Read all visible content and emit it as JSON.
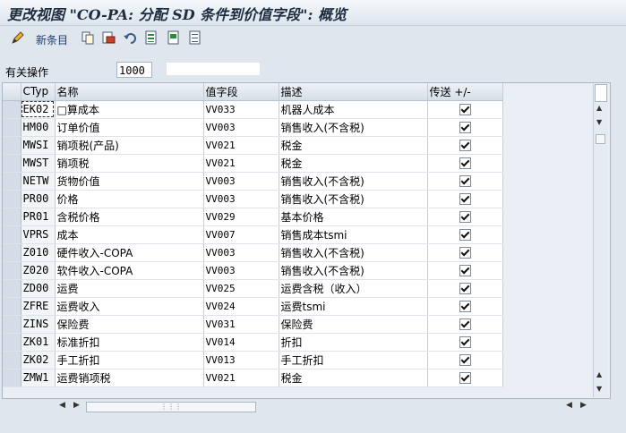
{
  "window": {
    "title": "更改视图 \"CO-PA: 分配 SD 条件到价值字段\": 概览"
  },
  "toolbar": {
    "new_entries_label": "新条目"
  },
  "related": {
    "label": "有关操作",
    "value": "1000"
  },
  "table": {
    "headers": {
      "code": "CTyp",
      "name": "名称",
      "field": "值字段",
      "desc": "描述",
      "transfer": "传送 +/-"
    },
    "rows": [
      {
        "code": "EK02",
        "name": "□算成本",
        "field": "VV033",
        "desc": "机器人成本",
        "transfer": true
      },
      {
        "code": "HM00",
        "name": "订单价值",
        "field": "VV003",
        "desc": "销售收入(不含税)",
        "transfer": true
      },
      {
        "code": "MWSI",
        "name": "销项税(产品)",
        "field": "VV021",
        "desc": "税金",
        "transfer": true
      },
      {
        "code": "MWST",
        "name": "销项税",
        "field": "VV021",
        "desc": "税金",
        "transfer": true
      },
      {
        "code": "NETW",
        "name": "货物价值",
        "field": "VV003",
        "desc": "销售收入(不含税)",
        "transfer": true
      },
      {
        "code": "PR00",
        "name": "价格",
        "field": "VV003",
        "desc": "销售收入(不含税)",
        "transfer": true
      },
      {
        "code": "PR01",
        "name": "含税价格",
        "field": "VV029",
        "desc": "基本价格",
        "transfer": true
      },
      {
        "code": "VPRS",
        "name": "成本",
        "field": "VV007",
        "desc": "销售成本tsmi",
        "transfer": true
      },
      {
        "code": "Z010",
        "name": "硬件收入-COPA",
        "field": "VV003",
        "desc": "销售收入(不含税)",
        "transfer": true
      },
      {
        "code": "Z020",
        "name": "软件收入-COPA",
        "field": "VV003",
        "desc": "销售收入(不含税)",
        "transfer": true
      },
      {
        "code": "ZD00",
        "name": "运费",
        "field": "VV025",
        "desc": "运费含税（收入）",
        "transfer": true
      },
      {
        "code": "ZFRE",
        "name": "运费收入",
        "field": "VV024",
        "desc": "运费tsmi",
        "transfer": true
      },
      {
        "code": "ZINS",
        "name": "保险费",
        "field": "VV031",
        "desc": "保险费",
        "transfer": true
      },
      {
        "code": "ZK01",
        "name": "标准折扣",
        "field": "VV014",
        "desc": "折扣",
        "transfer": true
      },
      {
        "code": "ZK02",
        "name": "手工折扣",
        "field": "VV013",
        "desc": "手工折扣",
        "transfer": true
      },
      {
        "code": "ZMW1",
        "name": "运费销项税",
        "field": "VV021",
        "desc": "税金",
        "transfer": true
      }
    ]
  },
  "icons": [
    "pencil-icon",
    "copy-icon",
    "delete-icon",
    "undo-icon",
    "select-all-icon",
    "select-block-icon",
    "deselect-all-icon"
  ],
  "colors": {
    "background": "#dfe6ee",
    "header": "#d6dee7",
    "cell": "#ffffff"
  }
}
